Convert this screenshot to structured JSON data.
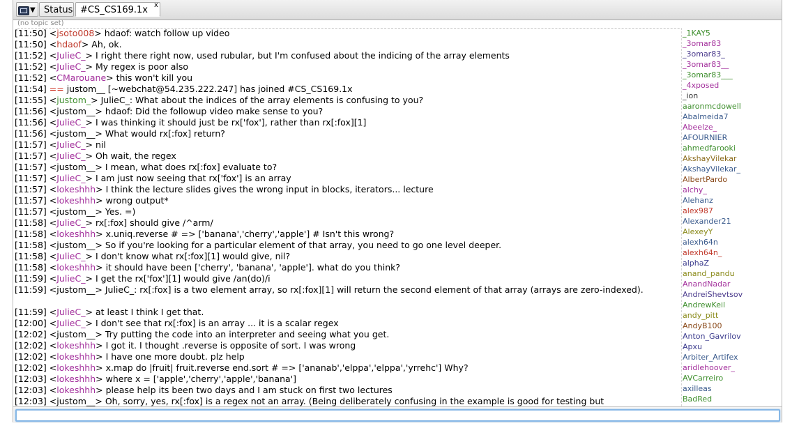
{
  "tabs": {
    "menu_caret": "▼",
    "status_label": "Status",
    "channel_label": "#CS_CS169.1x",
    "close_glyph": "x"
  },
  "topic": "(no topic set)",
  "log": [
    {
      "time": "[11:50]",
      "nick": "jsoto008",
      "color": "red",
      "msg": " hdaof: watch follow up video"
    },
    {
      "time": "[11:50]",
      "nick": "hdaof",
      "color": "red",
      "msg": " Ah, ok."
    },
    {
      "time": "[11:52]",
      "nick": "JulieC_",
      "color": "purple",
      "msg": " I right there right now, used rubular, but I'm confused about the indicing of the array elements"
    },
    {
      "time": "[11:52]",
      "nick": "JulieC_",
      "color": "purple",
      "msg": " My regex is poor also"
    },
    {
      "time": "[11:52]",
      "nick": "CMarouane",
      "color": "purple",
      "msg": " this won't kill you"
    },
    {
      "time": "[11:54]",
      "join": true,
      "marker": "==",
      "msg": " justom__ [~webchat@54.235.222.247] has joined #CS_CS169.1x"
    },
    {
      "time": "[11:55]",
      "nick": "justom_",
      "color": "green",
      "msg": " JulieC_: What about the indices of the array elements is confusing to you?"
    },
    {
      "time": "[11:56]",
      "nick": "justom__",
      "color": "dark",
      "msg": " hdaof: Did the followup video make sense to you?"
    },
    {
      "time": "[11:56]",
      "nick": "JulieC_",
      "color": "purple",
      "msg": " I was thinking it should just be rx['fox'], rather than rx[:fox][1]"
    },
    {
      "time": "[11:56]",
      "nick": "justom__",
      "color": "dark",
      "msg": " What would rx[:fox] return?"
    },
    {
      "time": "[11:57]",
      "nick": "JulieC_",
      "color": "purple",
      "msg": " nil"
    },
    {
      "time": "[11:57]",
      "nick": "JulieC_",
      "color": "purple",
      "msg": " Oh wait, the regex"
    },
    {
      "time": "[11:57]",
      "nick": "justom__",
      "color": "dark",
      "msg": " I mean, what does rx[:fox] evaluate to?"
    },
    {
      "time": "[11:57]",
      "nick": "JulieC_",
      "color": "purple",
      "msg": " I am just now seeing that rx['fox'] is an array"
    },
    {
      "time": "[11:57]",
      "nick": "lokeshhh",
      "color": "purple",
      "msg": " I think the lecture slides gives the wrong input in blocks, iterators... lecture"
    },
    {
      "time": "[11:57]",
      "nick": "lokeshhh",
      "color": "purple",
      "msg": " wrong output*"
    },
    {
      "time": "[11:57]",
      "nick": "justom__",
      "color": "dark",
      "msg": " Yes. =)"
    },
    {
      "time": "[11:58]",
      "nick": "JulieC_",
      "color": "purple",
      "msg": " rx[:fox] should give /^arm/"
    },
    {
      "time": "[11:58]",
      "nick": "lokeshhh",
      "color": "purple",
      "msg": " x.uniq.reverse # => ['banana','cherry','apple'] # Isn't this wrong?"
    },
    {
      "time": "[11:58]",
      "nick": "justom__",
      "color": "dark",
      "msg": " So if you're looking for a particular element of that array, you need to go one level deeper."
    },
    {
      "time": "[11:58]",
      "nick": "JulieC_",
      "color": "purple",
      "msg": " I don't know what rx[:fox][1] would give, nil?"
    },
    {
      "time": "[11:58]",
      "nick": "lokeshhh",
      "color": "purple",
      "msg": " it should have been ['cherry', 'banana', 'apple']. what do you think?"
    },
    {
      "time": "[11:59]",
      "nick": "JulieC_",
      "color": "purple",
      "msg": " I get the rx['fox'][1] would give /an(do)/i"
    },
    {
      "time": "[11:59]",
      "nick": "justom__",
      "color": "dark",
      "wrap": true,
      "msg": " JulieC_: rx[:fox] is a two element array, so rx[:fox][1] will return the second element of that array (arrays are zero-indexed)."
    },
    {
      "time": "[11:59]",
      "nick": "JulieC_",
      "color": "purple",
      "msg": " at least I think I get that."
    },
    {
      "time": "[12:00]",
      "nick": "JulieC_",
      "color": "purple",
      "msg": " I don't see that rx[:fox] is an array ... it is a scalar regex"
    },
    {
      "time": "[12:02]",
      "nick": "justom__",
      "color": "dark",
      "msg": " Try putting the code into an interpreter and seeing what you get."
    },
    {
      "time": "[12:02]",
      "nick": "lokeshhh",
      "color": "purple",
      "msg": " I got it. I thought .reverse is opposite of sort. I was wrong"
    },
    {
      "time": "[12:02]",
      "nick": "lokeshhh",
      "color": "purple",
      "msg": " I have one more doubt. plz help"
    },
    {
      "time": "[12:02]",
      "nick": "lokeshhh",
      "color": "purple",
      "msg": " x.map do |fruit| fruit.reverse end.sort # => ['ananab','elppa','elppa','yrrehc'] Why?"
    },
    {
      "time": "[12:03]",
      "nick": "lokeshhh",
      "color": "purple",
      "msg": " where x = ['apple','cherry','apple','banana']"
    },
    {
      "time": "[12:03]",
      "nick": "lokeshhh",
      "color": "purple",
      "msg": " please help its been two days and I am stuck on first two lectures"
    },
    {
      "time": "[12:03]",
      "nick": "justom__",
      "color": "dark",
      "msg": " Oh, sorry, yes, rx[:fox] is a regex not an array.  (Being deliberately confusing in the example is good for testing but"
    }
  ],
  "users": [
    {
      "name": "_1KAY5",
      "color": "#3f8f2e"
    },
    {
      "name": "_3omar83",
      "color": "#a3309c"
    },
    {
      "name": "_3omar83_",
      "color": "#4a3a8c"
    },
    {
      "name": "_3omar83__",
      "color": "#a3309c"
    },
    {
      "name": "_3omar83___",
      "color": "#3f8f2e"
    },
    {
      "name": "_4xposed",
      "color": "#a3309c"
    },
    {
      "name": "_ion",
      "color": "#333333"
    },
    {
      "name": "aaronmcdowell",
      "color": "#3f8f2e"
    },
    {
      "name": "Abalmeida7",
      "color": "#3a5a8c"
    },
    {
      "name": "Abeelze_",
      "color": "#a3309c"
    },
    {
      "name": "AFOURNIER",
      "color": "#3a5a8c"
    },
    {
      "name": "ahmedfarooki",
      "color": "#3f8f2e"
    },
    {
      "name": "AkshayVilekar",
      "color": "#8a6a1a"
    },
    {
      "name": "AkshayVilekar_",
      "color": "#3a5a8c"
    },
    {
      "name": "AlbertPardo",
      "color": "#8a4a1a"
    },
    {
      "name": "alchy_",
      "color": "#a3309c"
    },
    {
      "name": "Alehanz",
      "color": "#3a5a8c"
    },
    {
      "name": "alex987",
      "color": "#c0392b"
    },
    {
      "name": "Alexander21",
      "color": "#3a5a8c"
    },
    {
      "name": "AlexeyY",
      "color": "#8a8a1a"
    },
    {
      "name": "alexh64n",
      "color": "#3a5a8c"
    },
    {
      "name": "alexh64n_",
      "color": "#c0392b"
    },
    {
      "name": "alphaZ",
      "color": "#3a3a8c"
    },
    {
      "name": "anand_pandu",
      "color": "#8a8a1a"
    },
    {
      "name": "AnandNadar",
      "color": "#a3309c"
    },
    {
      "name": "AndreiShevtsov",
      "color": "#4a3a8c"
    },
    {
      "name": "AndrewKeil",
      "color": "#3f8f2e"
    },
    {
      "name": "andy_pitt",
      "color": "#8a8a1a"
    },
    {
      "name": "AndyB100",
      "color": "#8a4a1a"
    },
    {
      "name": "Anton_Gavrilov",
      "color": "#3a3a8c"
    },
    {
      "name": "Apxu",
      "color": "#3a3a8c"
    },
    {
      "name": "Arbiter_Artifex",
      "color": "#3a5a8c"
    },
    {
      "name": "aridlehoover_",
      "color": "#a3309c"
    },
    {
      "name": "AVCarreiro",
      "color": "#3f8f2e"
    },
    {
      "name": "axilleas",
      "color": "#3a5a8c"
    },
    {
      "name": "BadRed",
      "color": "#3f8f2e"
    }
  ],
  "input": {
    "value": ""
  }
}
